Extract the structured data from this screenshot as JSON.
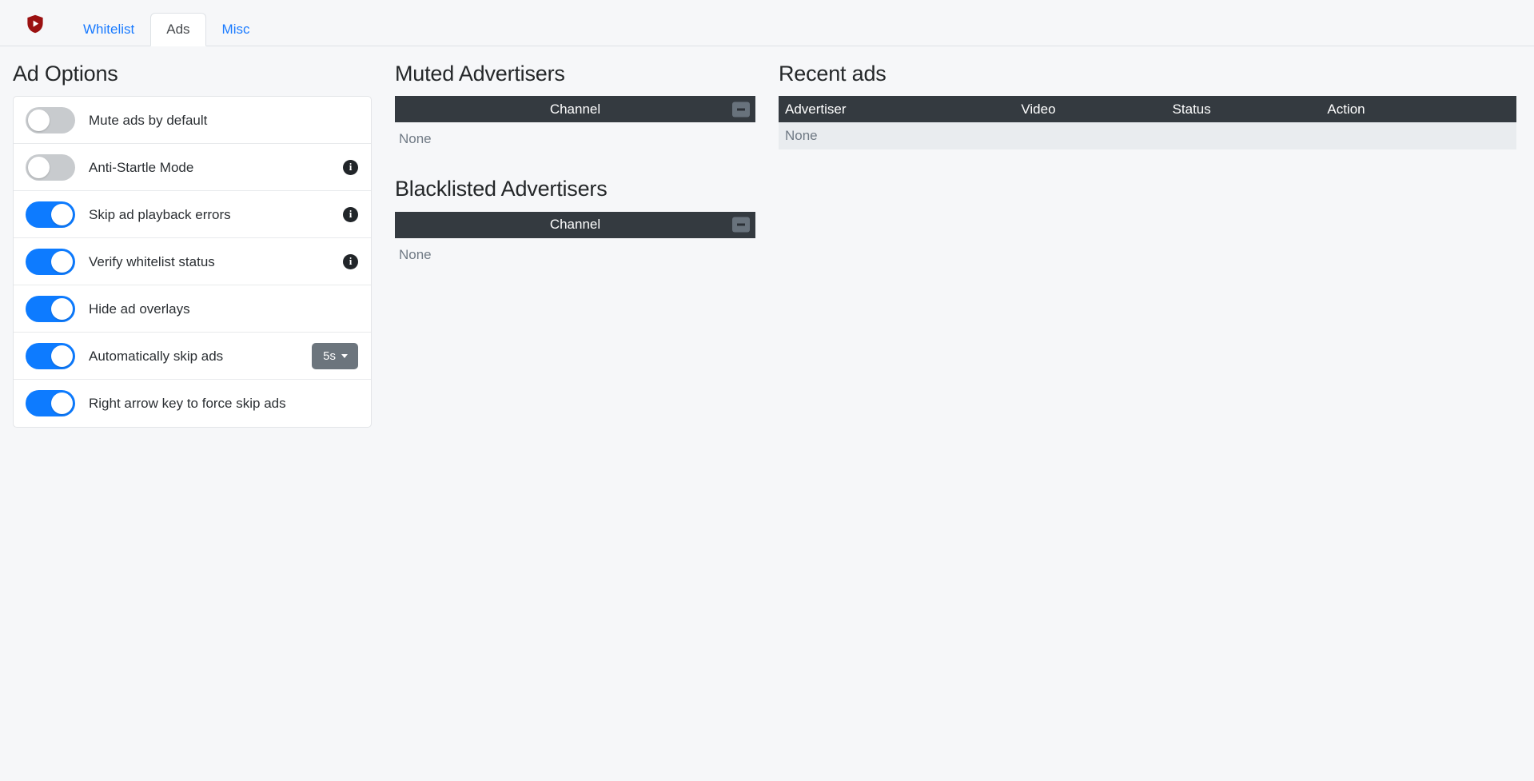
{
  "header": {
    "logo_icon": "shield-play-icon",
    "logo_color": "#9b1111",
    "tabs": [
      {
        "label": "Whitelist",
        "active": false
      },
      {
        "label": "Ads",
        "active": true
      },
      {
        "label": "Misc",
        "active": false
      }
    ]
  },
  "ad_options": {
    "title": "Ad Options",
    "rows": [
      {
        "label": "Mute ads by default",
        "on": false,
        "info": false,
        "control": null
      },
      {
        "label": "Anti-Startle Mode",
        "on": false,
        "info": true,
        "control": null
      },
      {
        "label": "Skip ad playback errors",
        "on": true,
        "info": true,
        "control": null
      },
      {
        "label": "Verify whitelist status",
        "on": true,
        "info": true,
        "control": null
      },
      {
        "label": "Hide ad overlays",
        "on": true,
        "info": false,
        "control": null
      },
      {
        "label": "Automatically skip ads",
        "on": true,
        "info": false,
        "control": "5s"
      },
      {
        "label": "Right arrow key to force skip ads",
        "on": true,
        "info": false,
        "control": null
      }
    ]
  },
  "muted_advertisers": {
    "title": "Muted Advertisers",
    "column_header": "Channel",
    "collapse_icon": "minus-icon",
    "empty_text": "None"
  },
  "blacklisted_advertisers": {
    "title": "Blacklisted Advertisers",
    "column_header": "Channel",
    "collapse_icon": "minus-icon",
    "empty_text": "None"
  },
  "recent_ads": {
    "title": "Recent ads",
    "columns": [
      "Advertiser",
      "Video",
      "Status",
      "Action"
    ],
    "rows": [],
    "empty_text": "None"
  },
  "colors": {
    "accent_blue": "#0d7bff",
    "link_blue": "#1a7bff",
    "dark_header": "#343a40",
    "page_bg": "#f6f7f9",
    "empty_row_bg": "#e9ecef",
    "muted_text": "#707a85",
    "secondary_btn": "#6c757d"
  }
}
